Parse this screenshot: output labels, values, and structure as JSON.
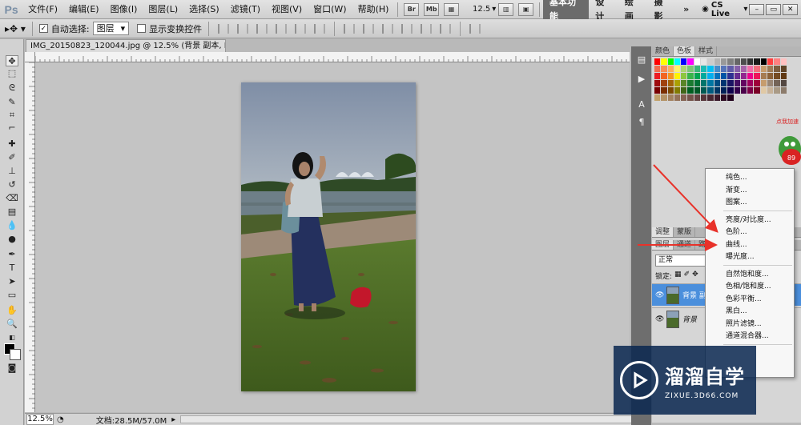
{
  "menu": {
    "logo": "Ps",
    "items": [
      "文件(F)",
      "编辑(E)",
      "图像(I)",
      "图层(L)",
      "选择(S)",
      "滤镜(T)",
      "视图(V)",
      "窗口(W)",
      "帮助(H)"
    ],
    "br": "Br",
    "mb": "Mb",
    "zoom": "12.5",
    "workspaces": [
      "基本功能",
      "设计",
      "绘画",
      "摄影"
    ],
    "more": "»",
    "cslive": "CS Live",
    "window_controls": [
      "–",
      "▭",
      "✕"
    ]
  },
  "options": {
    "auto_select_label": "自动选择:",
    "auto_select_checked": true,
    "auto_select_target": "图层",
    "transform_label": "显示变换控件",
    "transform_checked": false
  },
  "document": {
    "tab_title": "IMG_20150823_120044.jpg @ 12.5% (背景 副本, RGB/8) *",
    "close": "×"
  },
  "status": {
    "zoom": "12.5%",
    "doc_size": "文档:28.5M/57.0M"
  },
  "swatch_panel": {
    "tabs": [
      "颜色",
      "色板",
      "样式"
    ],
    "active_tab": "色板"
  },
  "layers_panel": {
    "top_tabs": [
      "调整",
      "蒙版"
    ],
    "tabs": [
      "图层",
      "通道",
      "路径"
    ],
    "blend_mode": "正常",
    "lock_label": "锁定:",
    "layers": [
      {
        "name": "背景 副",
        "selected": true
      },
      {
        "name": "背景",
        "selected": false
      }
    ]
  },
  "context_menu": {
    "items": [
      "纯色...",
      "渐变...",
      "图案...",
      "亮度/对比度...",
      "色阶...",
      "曲线...",
      "曝光度...",
      "自然饱和度...",
      "色相/饱和度...",
      "色彩平衡...",
      "黑白...",
      "照片滤镜...",
      "通道混合器..."
    ]
  },
  "watermark": {
    "title": "溜溜自学",
    "url": "ZIXUE.3D66.COM"
  },
  "mascot": {
    "label": "点我加速",
    "badge": "89"
  },
  "colors": {
    "arrow": "#e8322a",
    "selected_layer": "#4b8fdc",
    "dock": "#6e6e6e"
  }
}
